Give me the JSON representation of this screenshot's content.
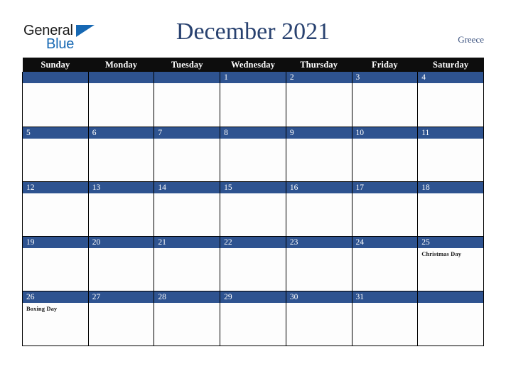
{
  "brand": {
    "word_one": "General",
    "word_two": "Blue",
    "triangle_icon": "blue-triangle-icon",
    "color_dark": "#1a1a1a",
    "color_blue": "#1668b3"
  },
  "header": {
    "title": "December 2021",
    "month": "December",
    "year": "2021",
    "country": "Greece",
    "title_color": "#294270",
    "country_color": "#3d5480"
  },
  "colors": {
    "header_row_bg": "#0d0d0d",
    "header_row_text": "#ffffff",
    "date_bar_bg": "#2e5390",
    "date_bar_text": "#ffffff",
    "cell_bg": "#fdfdfd",
    "grid_line": "#000000",
    "holiday_text": "#1a1a1a"
  },
  "calendar": {
    "day_headers": [
      "Sunday",
      "Monday",
      "Tuesday",
      "Wednesday",
      "Thursday",
      "Friday",
      "Saturday"
    ],
    "weeks": [
      [
        {
          "date": "",
          "holiday": ""
        },
        {
          "date": "",
          "holiday": ""
        },
        {
          "date": "",
          "holiday": ""
        },
        {
          "date": "1",
          "holiday": ""
        },
        {
          "date": "2",
          "holiday": ""
        },
        {
          "date": "3",
          "holiday": ""
        },
        {
          "date": "4",
          "holiday": ""
        }
      ],
      [
        {
          "date": "5",
          "holiday": ""
        },
        {
          "date": "6",
          "holiday": ""
        },
        {
          "date": "7",
          "holiday": ""
        },
        {
          "date": "8",
          "holiday": ""
        },
        {
          "date": "9",
          "holiday": ""
        },
        {
          "date": "10",
          "holiday": ""
        },
        {
          "date": "11",
          "holiday": ""
        }
      ],
      [
        {
          "date": "12",
          "holiday": ""
        },
        {
          "date": "13",
          "holiday": ""
        },
        {
          "date": "14",
          "holiday": ""
        },
        {
          "date": "15",
          "holiday": ""
        },
        {
          "date": "16",
          "holiday": ""
        },
        {
          "date": "17",
          "holiday": ""
        },
        {
          "date": "18",
          "holiday": ""
        }
      ],
      [
        {
          "date": "19",
          "holiday": ""
        },
        {
          "date": "20",
          "holiday": ""
        },
        {
          "date": "21",
          "holiday": ""
        },
        {
          "date": "22",
          "holiday": ""
        },
        {
          "date": "23",
          "holiday": ""
        },
        {
          "date": "24",
          "holiday": ""
        },
        {
          "date": "25",
          "holiday": "Christmas Day"
        }
      ],
      [
        {
          "date": "26",
          "holiday": "Boxing Day"
        },
        {
          "date": "27",
          "holiday": ""
        },
        {
          "date": "28",
          "holiday": ""
        },
        {
          "date": "29",
          "holiday": ""
        },
        {
          "date": "30",
          "holiday": ""
        },
        {
          "date": "31",
          "holiday": ""
        },
        {
          "date": "",
          "holiday": ""
        }
      ]
    ]
  }
}
